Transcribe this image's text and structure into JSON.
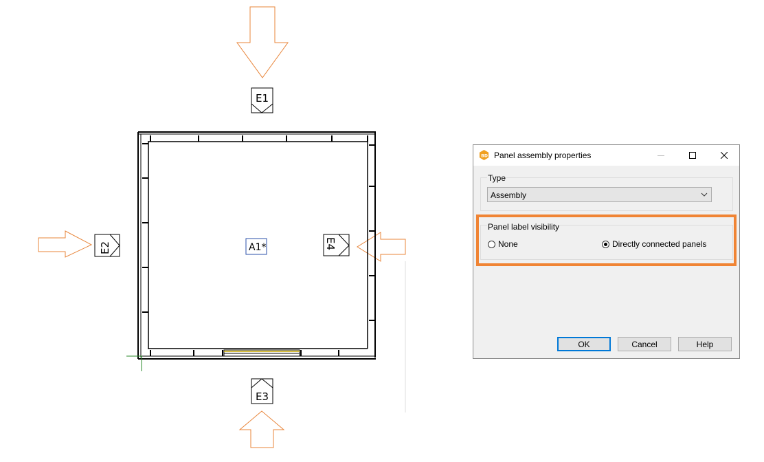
{
  "drawing": {
    "elevation_labels": {
      "e1": "E1",
      "e2": "E2",
      "e3": "E3",
      "e4": "E4"
    },
    "assembly_label": "A1*",
    "colors": {
      "arrow": "#e8853a",
      "wall": "#000000",
      "origin_axis": "#2a8a2a"
    }
  },
  "dialog": {
    "title": "Panel assembly properties",
    "app_icon": "bd-app-icon",
    "window_controls": [
      "minimize-icon",
      "maximize-icon",
      "close-icon"
    ],
    "type_group": {
      "label": "Type",
      "selected": "Assembly"
    },
    "visibility_group": {
      "label": "Panel label visibility",
      "options": [
        {
          "label": "None",
          "selected": false
        },
        {
          "label": "Directly connected panels",
          "selected": true
        }
      ]
    },
    "buttons": {
      "ok": "OK",
      "cancel": "Cancel",
      "help": "Help"
    },
    "colors": {
      "highlight": "#f08434",
      "default_button_border": "#0078d7"
    }
  }
}
